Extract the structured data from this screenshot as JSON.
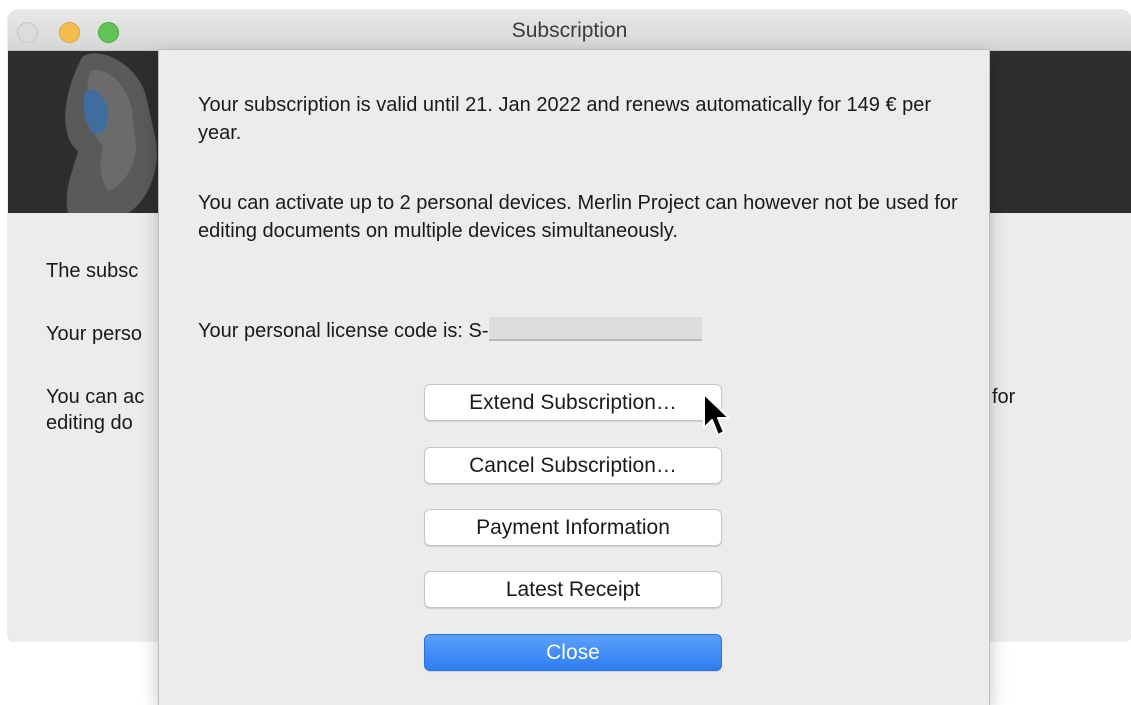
{
  "window": {
    "title": "Subscription",
    "background_text": {
      "line1": "The subsc",
      "line2": "Your perso",
      "line3": "You can ac",
      "line3_tail": "for",
      "line4": "editing do"
    }
  },
  "sheet": {
    "paragraph1": "Your subscription is valid until 21. Jan 2022 and renews automatically for 149 € per year.",
    "paragraph2": "You can activate up to 2 personal devices. Merlin Project can however not be used for editing documents on multiple devices simultaneously.",
    "license_label": "Your personal license code is: S-",
    "buttons": {
      "extend": "Extend Subscription…",
      "cancel": "Cancel Subscription…",
      "payment": "Payment Information",
      "receipt": "Latest Receipt",
      "close": "Close"
    }
  },
  "colors": {
    "accent": "#2e7cf2",
    "banner": "#2e2e2e"
  }
}
